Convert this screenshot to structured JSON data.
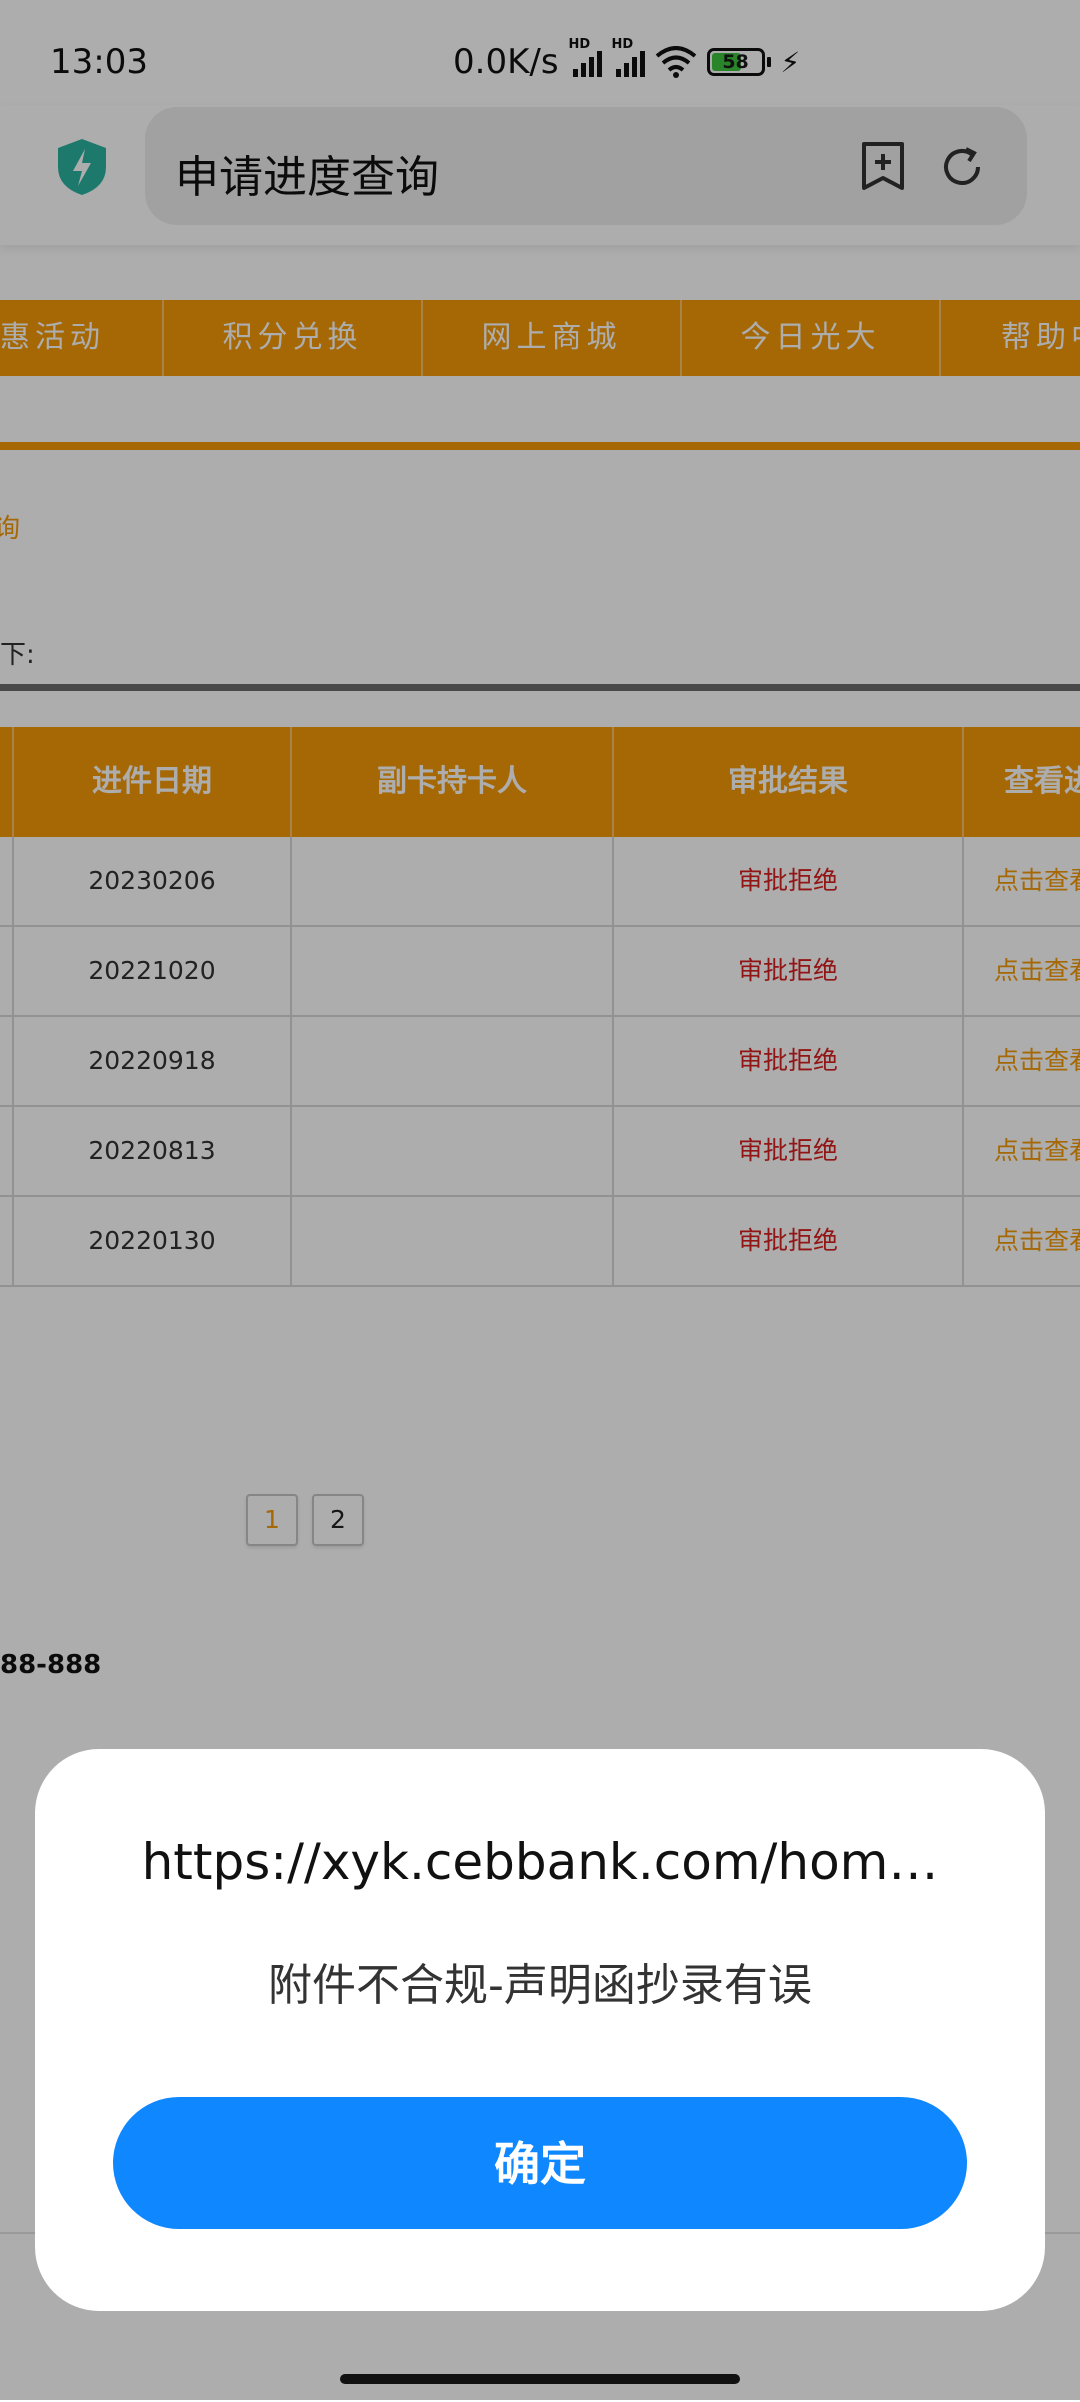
{
  "status_bar": {
    "time": "13:03",
    "net_speed": "0.0K/s",
    "hd1": "HD",
    "hd2": "HD",
    "battery": "58",
    "battery_level": 0.58
  },
  "browser": {
    "address_title": "申请进度查询",
    "icons": [
      "shield-icon",
      "bookmark-add-icon",
      "refresh-icon"
    ]
  },
  "nav": {
    "items": [
      "惠活动",
      "积分兑换",
      "网上商城",
      "今日光大",
      "帮助中"
    ]
  },
  "page": {
    "breadcrumb": "询",
    "intro": "下:",
    "phone": "88-888"
  },
  "table": {
    "headers": [
      "进件日期",
      "副卡持卡人",
      "审批结果",
      "查看进"
    ],
    "rows": [
      {
        "date": "20230206",
        "secondary": "",
        "result": "审批拒绝",
        "view": "点击查看"
      },
      {
        "date": "20221020",
        "secondary": "",
        "result": "审批拒绝",
        "view": "点击查看"
      },
      {
        "date": "20220918",
        "secondary": "",
        "result": "审批拒绝",
        "view": "点击查看"
      },
      {
        "date": "20220813",
        "secondary": "",
        "result": "审批拒绝",
        "view": "点击查看"
      },
      {
        "date": "20220130",
        "secondary": "",
        "result": "审批拒绝",
        "view": "点击查看"
      }
    ]
  },
  "pagination": {
    "pages": [
      "1",
      "2"
    ],
    "current": "1"
  },
  "dialog": {
    "title": "https://xyk.cebbank.com/hom…",
    "message": "附件不合规-声明函抄录有误",
    "confirm": "确定"
  },
  "colors": {
    "accent_orange": "#f39a08",
    "reject_red": "#d81e1e",
    "button_blue": "#0f87ff"
  }
}
